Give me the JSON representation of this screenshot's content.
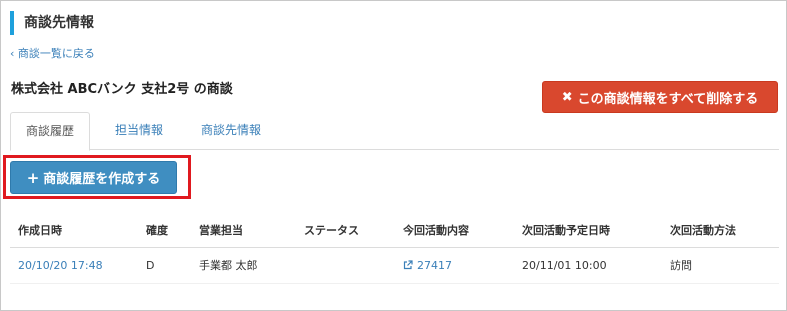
{
  "section": {
    "title": "商談先情報"
  },
  "nav": {
    "back_label": "‹ 商談一覧に戻る"
  },
  "header": {
    "title": "株式会社 ABCバンク 支社2号 の商談",
    "delete_button_label": "この商談情報をすべて削除する"
  },
  "tabs": [
    {
      "label": "商談履歴",
      "active": true
    },
    {
      "label": "担当情報",
      "active": false
    },
    {
      "label": "商談先情報",
      "active": false
    }
  ],
  "actions": {
    "create_button_label": "商談履歴を作成する"
  },
  "table": {
    "columns": [
      "作成日時",
      "確度",
      "営業担当",
      "ステータス",
      "今回活動内容",
      "次回活動予定日時",
      "次回活動方法"
    ],
    "rows": [
      {
        "created_at": "20/10/20 17:48",
        "probability": "D",
        "sales_rep": "手業都 太郎",
        "status": "",
        "activity": "27417",
        "next_date": "20/11/01 10:00",
        "next_method": "訪問"
      }
    ]
  },
  "colors": {
    "accent": "#1ea0dc",
    "danger": "#d9482e",
    "primary": "#3f8ec1",
    "highlight": "#e0191f",
    "link": "#3a7fb8"
  }
}
